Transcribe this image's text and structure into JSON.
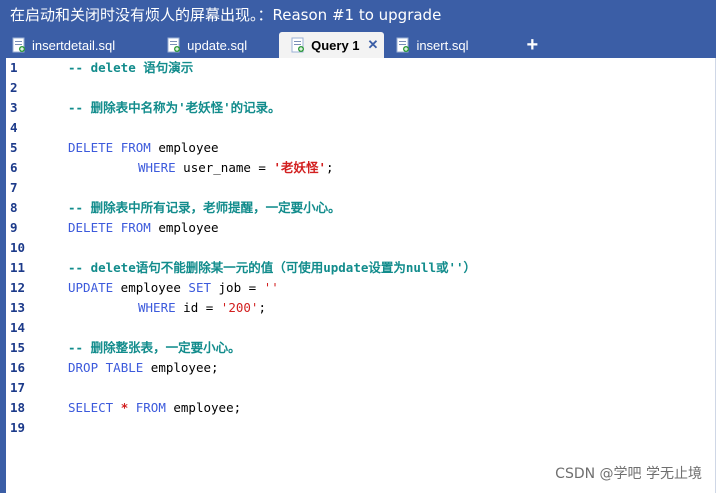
{
  "title_bar": {
    "text": "在启动和关闭时没有烦人的屏幕出现。：Reason #1 to upgrade"
  },
  "tabs": [
    {
      "label": "insertdetail.sql",
      "active": false
    },
    {
      "label": "update.sql",
      "active": false
    },
    {
      "label": "Query 1",
      "active": true,
      "close": "✕"
    },
    {
      "label": "insert.sql",
      "active": false
    }
  ],
  "add_tab": "+",
  "colors": {
    "accent": "#3b5ea6",
    "comment": "#128c8c",
    "keyword": "#3c5adc",
    "string": "#d21f1f",
    "line_number": "#1c3a8a"
  },
  "editor": {
    "lines": [
      {
        "n": "1",
        "tokens": [
          [
            "com",
            "-- delete 语句演示"
          ]
        ]
      },
      {
        "n": "2",
        "tokens": []
      },
      {
        "n": "3",
        "tokens": [
          [
            "com",
            "-- 删除表中名称为'老妖怪'的记录。"
          ]
        ]
      },
      {
        "n": "4",
        "tokens": []
      },
      {
        "n": "5",
        "tokens": [
          [
            "kw",
            "DELETE "
          ],
          [
            "kw",
            "FROM"
          ],
          [
            "id",
            " employee"
          ]
        ]
      },
      {
        "n": "6",
        "tokens": [
          [
            "ind",
            ""
          ],
          [
            "kw",
            "WHERE"
          ],
          [
            "id",
            " user_name = "
          ],
          [
            "strb",
            "'老妖怪'"
          ],
          [
            "id",
            ";"
          ]
        ]
      },
      {
        "n": "7",
        "tokens": []
      },
      {
        "n": "8",
        "tokens": [
          [
            "com",
            "-- 删除表中所有记录，老师提醒，一定要小心。"
          ]
        ]
      },
      {
        "n": "9",
        "tokens": [
          [
            "kw",
            "DELETE "
          ],
          [
            "kw",
            "FROM"
          ],
          [
            "id",
            " employee"
          ]
        ]
      },
      {
        "n": "10",
        "tokens": []
      },
      {
        "n": "11",
        "tokens": [
          [
            "com",
            "-- delete语句不能删除某一元的值（可使用update设置为null或''）"
          ]
        ]
      },
      {
        "n": "12",
        "tokens": [
          [
            "kw",
            "UPDATE"
          ],
          [
            "id",
            " employee "
          ],
          [
            "kw",
            "SET"
          ],
          [
            "id",
            " job = "
          ],
          [
            "str",
            "''"
          ]
        ]
      },
      {
        "n": "13",
        "tokens": [
          [
            "ind",
            ""
          ],
          [
            "kw",
            "WHERE"
          ],
          [
            "id",
            " id = "
          ],
          [
            "str",
            "'200'"
          ],
          [
            "id",
            ";"
          ]
        ]
      },
      {
        "n": "14",
        "tokens": []
      },
      {
        "n": "15",
        "tokens": [
          [
            "com",
            "-- 删除整张表，一定要小心。"
          ]
        ]
      },
      {
        "n": "16",
        "tokens": [
          [
            "kw",
            "DROP "
          ],
          [
            "kw",
            "TABLE"
          ],
          [
            "id",
            " employee;"
          ]
        ]
      },
      {
        "n": "17",
        "tokens": []
      },
      {
        "n": "18",
        "tokens": [
          [
            "kw",
            "SELECT "
          ],
          [
            "strb",
            "*"
          ],
          [
            "kw",
            " FROM"
          ],
          [
            "id",
            " employee;"
          ]
        ]
      },
      {
        "n": "19",
        "tokens": []
      }
    ]
  },
  "watermark": "CSDN @学吧 学无止境"
}
